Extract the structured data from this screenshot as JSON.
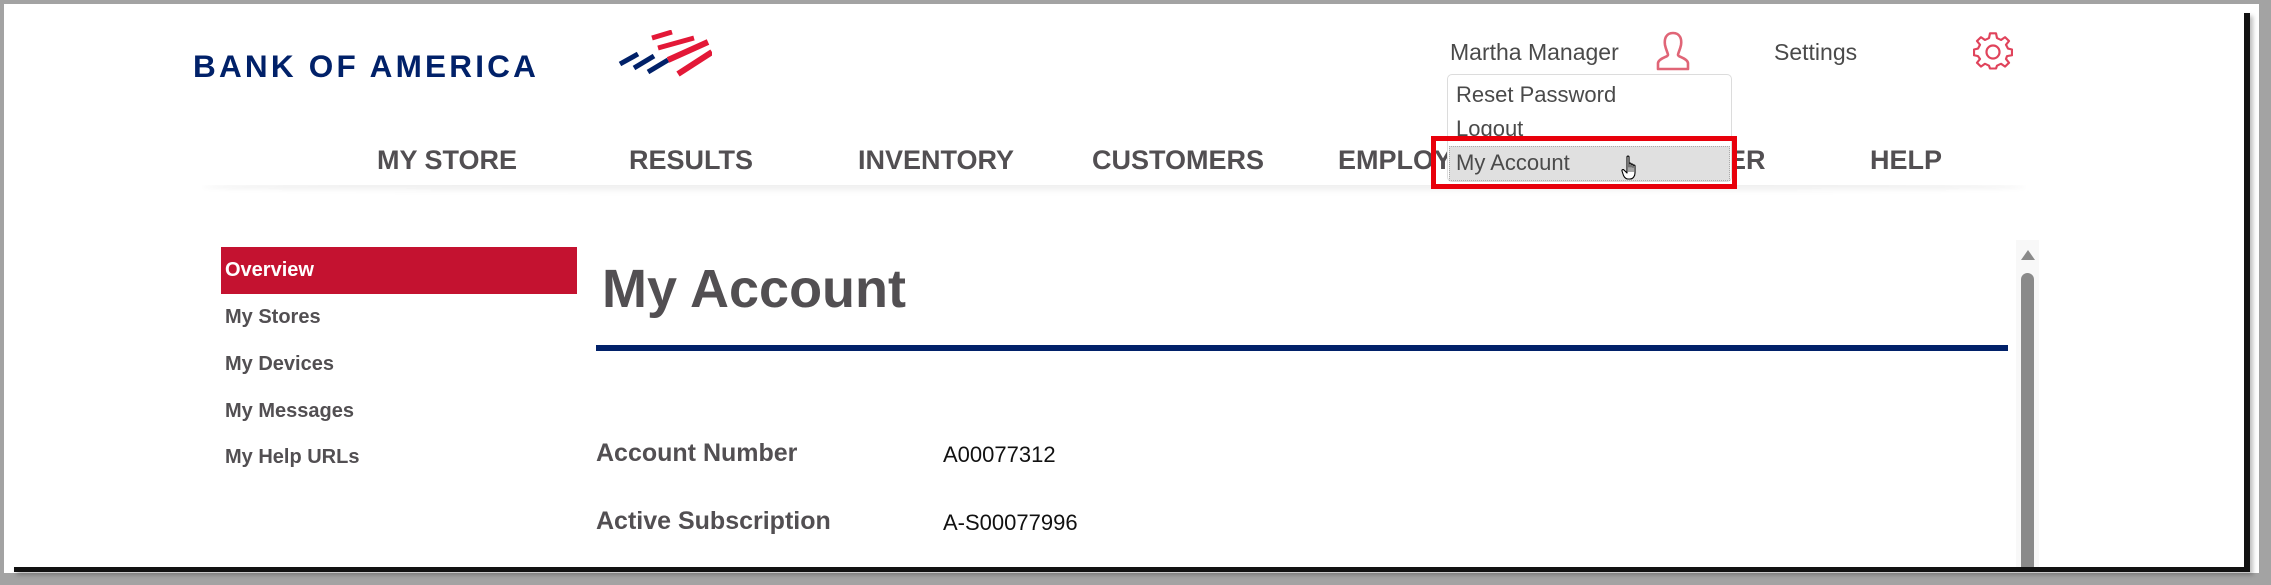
{
  "brand": {
    "logo_text": "BANK OF AMERICA",
    "logo_icon": "flag-logo-icon",
    "colors": {
      "navy": "#012169",
      "red": "#e31837",
      "accent_red": "#c41230"
    }
  },
  "header": {
    "user_name": "Martha Manager",
    "user_icon": "user-icon",
    "settings_label": "Settings",
    "settings_icon": "gear-icon"
  },
  "user_menu": {
    "items": [
      {
        "label": "Reset Password"
      },
      {
        "label": "Logout"
      },
      {
        "label": "My Account",
        "hovered": true
      }
    ]
  },
  "nav": {
    "items": [
      {
        "label": "MY STORE"
      },
      {
        "label": "RESULTS"
      },
      {
        "label": "INVENTORY"
      },
      {
        "label": "CUSTOMERS"
      },
      {
        "label": "EMPLOY"
      },
      {
        "label": "ER"
      },
      {
        "label": "HELP"
      }
    ]
  },
  "sidebar": {
    "items": [
      {
        "label": "Overview",
        "active": true
      },
      {
        "label": "My Stores"
      },
      {
        "label": "My Devices"
      },
      {
        "label": "My Messages"
      },
      {
        "label": "My Help URLs"
      }
    ]
  },
  "main": {
    "title": "My Account",
    "fields": [
      {
        "label": "Account Number",
        "value": "A00077312"
      },
      {
        "label": "Active Subscription",
        "value": "A-S00077996"
      }
    ]
  },
  "annotation": {
    "highlight_color": "#e8000b",
    "highlight_target": "My Account"
  }
}
